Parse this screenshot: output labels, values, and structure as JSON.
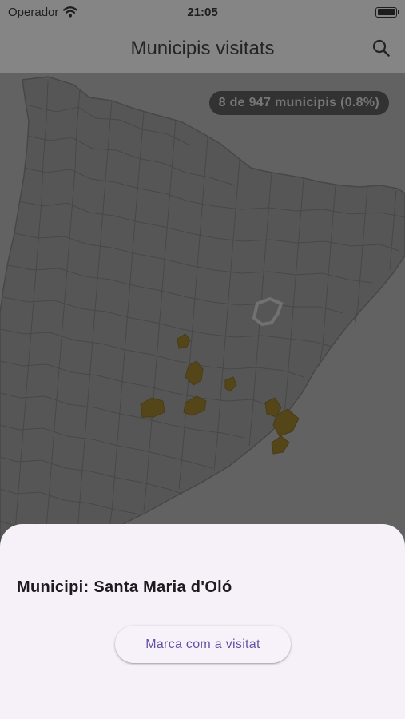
{
  "status_bar": {
    "carrier": "Operador",
    "time": "21:05",
    "battery_percent": 100,
    "icons": [
      "wifi-icon",
      "battery-icon"
    ]
  },
  "app_bar": {
    "title": "Municipis visitats",
    "search_icon": "search-icon"
  },
  "map": {
    "counter_label": "8 de 947 municipis (0.8%)",
    "visited_count": 8,
    "total_municipalities": 947,
    "visited_percent": 0.8,
    "colors": {
      "land": "#8f8f8f",
      "borders": "#6e6e6e",
      "sea": "#a8a8a8",
      "visited": "#8a6a05",
      "selected_outline": "#c9c9c9"
    }
  },
  "sheet": {
    "municipality_label": "Municipi: Santa Maria d'Oló",
    "mark_visited_button": "Marca com a visitat"
  },
  "theme": {
    "accent": "#6750a4",
    "sheet_background": "#f6f1f8",
    "scrim": "#282828"
  }
}
